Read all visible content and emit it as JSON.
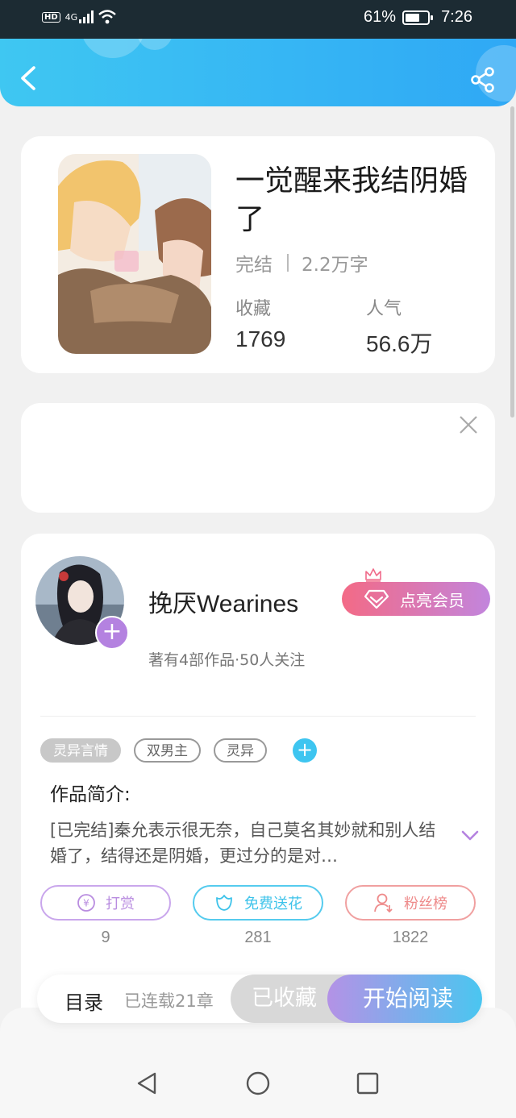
{
  "status_bar": {
    "hd": "HD",
    "network": "4G",
    "battery": "61%",
    "time": "7:26"
  },
  "book": {
    "title": "一觉醒来我结阴婚了",
    "status": "完结",
    "word_count": "2.2万字",
    "favorites_label": "收藏",
    "favorites_value": "1769",
    "popularity_label": "人气",
    "popularity_value": "56.6万"
  },
  "author": {
    "name": "挽厌Wearines",
    "stats": "著有4部作品·50人关注",
    "vip_label": "点亮会员"
  },
  "tags": [
    "灵异言情",
    "双男主",
    "灵异"
  ],
  "intro": {
    "title": "作品简介:",
    "text": "[已完结]秦允表示很无奈，自己莫名其妙就和别人结婚了，结得还是阴婚，更过分的是对…"
  },
  "actions": [
    {
      "label": "打赏",
      "count": "9",
      "color": "#b98de0",
      "icon": "yen-coin-icon"
    },
    {
      "label": "免费送花",
      "count": "281",
      "color": "#3ec3ea",
      "icon": "flower-icon"
    },
    {
      "label": "粉丝榜",
      "count": "1822",
      "color": "#ee8a8a",
      "icon": "user-rank-icon"
    }
  ],
  "bottom_bar": {
    "toc": "目录",
    "serial": "已连载21章",
    "collected": "已收藏",
    "start_reading": "开始阅读"
  },
  "colors": {
    "header_start": "#3fc7f2",
    "header_end": "#2fa8f5",
    "accent_purple": "#b482e0",
    "vip_gradient_start": "#f36a86"
  }
}
